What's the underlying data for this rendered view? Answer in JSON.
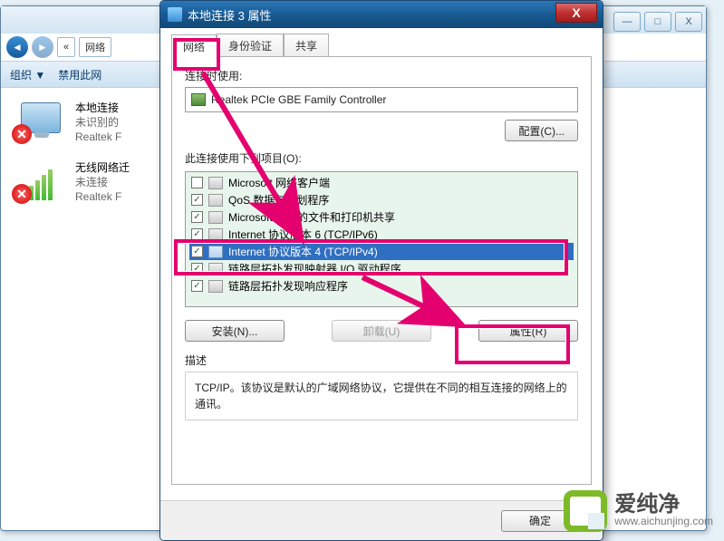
{
  "bgwin": {
    "min": "—",
    "max": "□",
    "close": "X",
    "crumb_prefix": "«",
    "crumb": "网络",
    "toolbar": {
      "org": "组织 ▼",
      "disable": "禁用此网"
    }
  },
  "sidebar": {
    "items": [
      {
        "name": "本地连接",
        "l2": "未识别的",
        "l3": "Realtek F"
      },
      {
        "name": "无线网络迁",
        "l2": "未连接",
        "l3": "Realtek F"
      }
    ]
  },
  "dialog": {
    "title": "本地连接 3 属性",
    "close_x": "X",
    "tabs": [
      "网络",
      "身份验证",
      "共享"
    ],
    "connect_using_label": "连接时使用:",
    "adapter": "Realtek PCIe GBE Family Controller",
    "configure_btn": "配置(C)...",
    "items_label": "此连接使用下列项目(O):",
    "items": [
      {
        "checked": false,
        "label": "Microsoft 网络客户端"
      },
      {
        "checked": true,
        "label": "QoS 数据包计划程序"
      },
      {
        "checked": true,
        "label": "Microsoft 网络的文件和打印机共享"
      },
      {
        "checked": true,
        "label": "Internet 协议版本 6 (TCP/IPv6)"
      },
      {
        "checked": true,
        "label": "Internet 协议版本 4 (TCP/IPv4)"
      },
      {
        "checked": true,
        "label": "链路层拓扑发现映射器 I/O 驱动程序"
      },
      {
        "checked": true,
        "label": "链路层拓扑发现响应程序"
      }
    ],
    "install_btn": "安装(N)...",
    "uninstall_btn": "卸载(U)",
    "properties_btn": "属性(R)",
    "desc_label": "描述",
    "desc_text": "TCP/IP。该协议是默认的广域网络协议，它提供在不同的相互连接的网络上的通讯。",
    "ok_btn": "确定"
  },
  "watermark": {
    "name": "爱纯净",
    "url": "www.aichunjing.com"
  },
  "colors": {
    "highlight": "#e4006e",
    "arrow": "#e4006e"
  }
}
